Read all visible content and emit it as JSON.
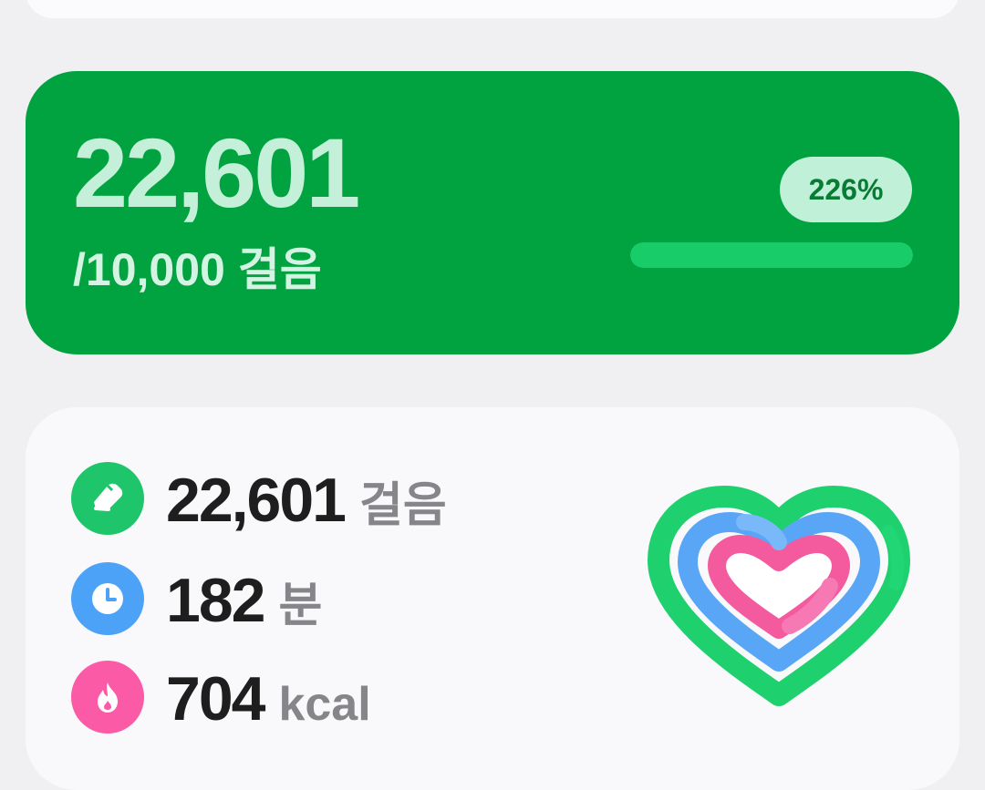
{
  "steps_card": {
    "steps": "22,601",
    "goal_text": "/10,000 걸음",
    "percent_label": "226%",
    "progress_fraction": 1.0
  },
  "summary": {
    "steps": {
      "value": "22,601",
      "unit": "걸음",
      "icon": "shoe-icon",
      "color": "#1fc56a"
    },
    "minutes": {
      "value": "182",
      "unit": "분",
      "icon": "clock-icon",
      "color": "#4ba2f7"
    },
    "calories": {
      "value": "704",
      "unit": "kcal",
      "icon": "flame-icon",
      "color": "#fb5aa7"
    }
  },
  "colors": {
    "card_green": "#00a33f",
    "ring_steps": "#1fd06e",
    "ring_minutes": "#5aa6f6",
    "ring_calories": "#f45a9e"
  }
}
